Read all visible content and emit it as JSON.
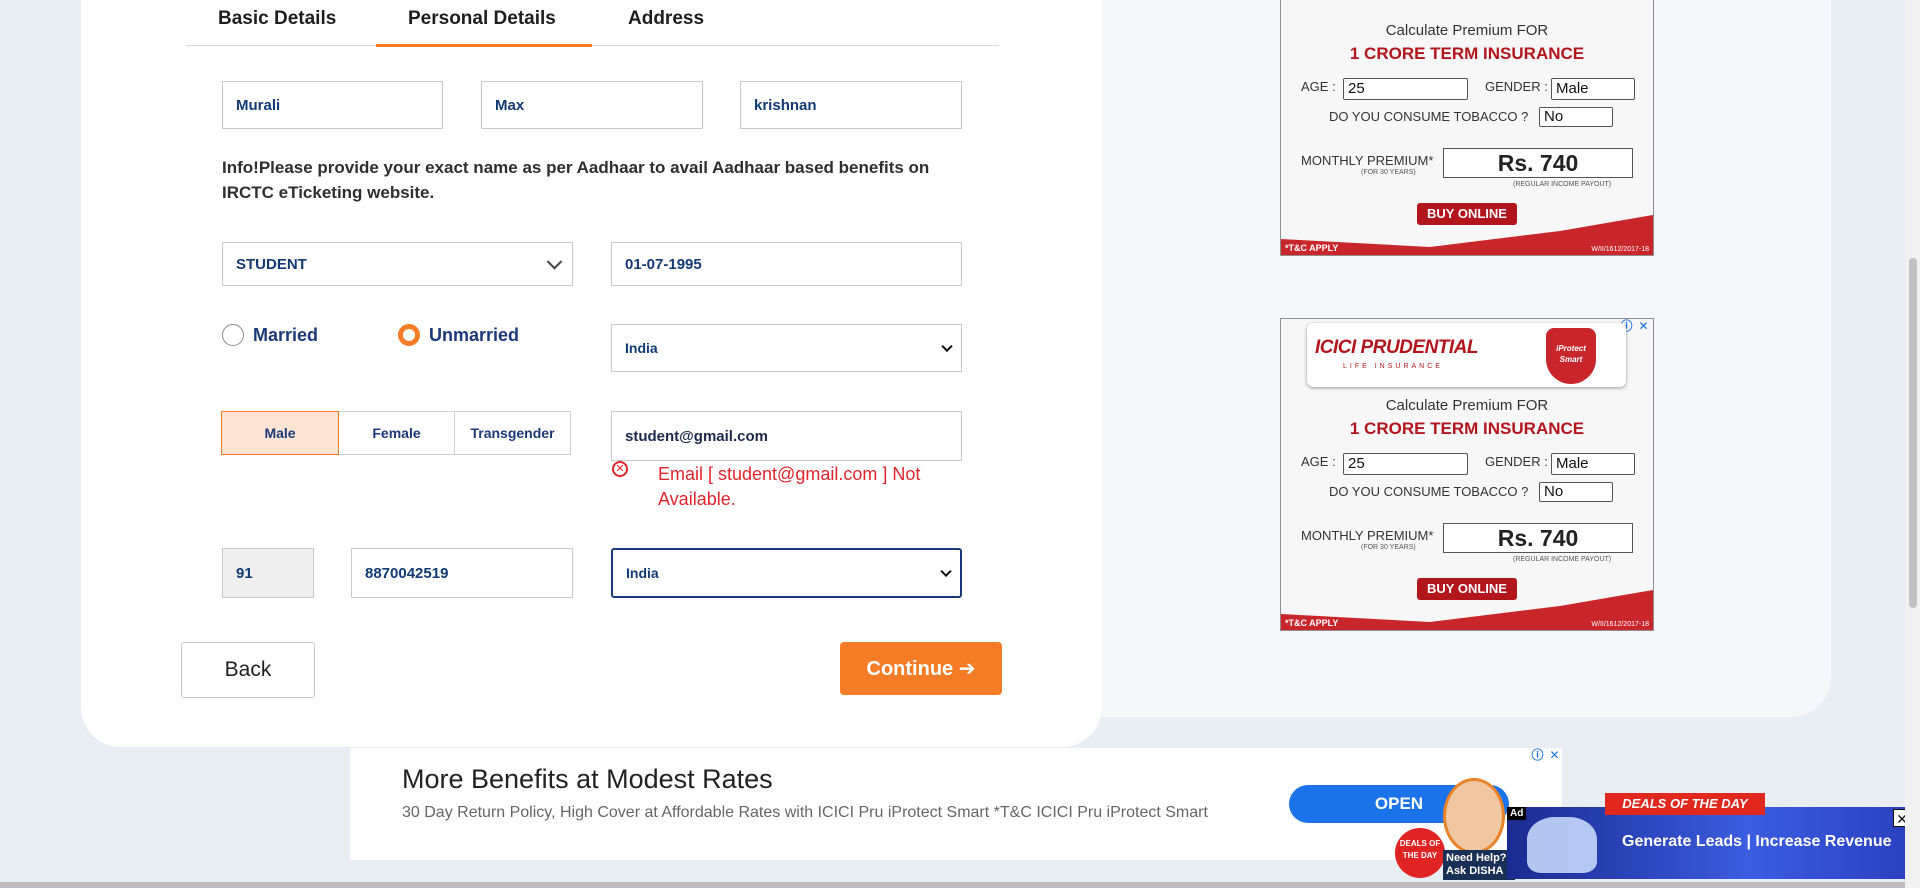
{
  "tabs": [
    "Basic Details",
    "Personal Details",
    "Address"
  ],
  "name": {
    "first": "Murali",
    "middle": "Max",
    "last": "krishnan"
  },
  "info_text": "Info!Please provide your exact name as per Aadhaar to avail Aadhaar based benefits on IRCTC eTicketing website.",
  "occupation": "STUDENT",
  "dob": "01-07-1995",
  "marital": {
    "married": "Married",
    "unmarried": "Unmarried",
    "selected": "Unmarried"
  },
  "country": "India",
  "gender": {
    "options": [
      "Male",
      "Female",
      "Transgender"
    ],
    "selected": "Male"
  },
  "email": "student@gmail.com",
  "email_error": "Email [ student@gmail.com ] Not Available.",
  "phone": {
    "isd": "91",
    "mobile": "8870042519",
    "nationality": "India"
  },
  "buttons": {
    "back": "Back",
    "continue": "Continue ➔"
  },
  "side_ad": {
    "brand": "ICICI PRUDENTIAL",
    "brand_sub": "LIFE INSURANCE",
    "shield": "iProtect Smart",
    "calc": "Calculate Premium FOR",
    "headline": "1 CRORE TERM INSURANCE",
    "age_label": "AGE :",
    "age_value": "25",
    "gender_label": "GENDER :",
    "gender_value": "Male",
    "tobacco_label": "DO YOU CONSUME TOBACCO ?",
    "tobacco_value": "No",
    "premium_label": "MONTHLY PREMIUM*",
    "premium_sub": "(FOR 30 YEARS)",
    "premium_value": "Rs. 740",
    "premium_note": "(REGULAR INCOME PAYOUT)",
    "buy": "BUY ONLINE",
    "tc": "*T&C APPLY",
    "code": "W/II/1612/2017-18"
  },
  "banner": {
    "title": "More Benefits at Modest Rates",
    "desc": "30 Day Return Policy, High Cover at Affordable Rates with ICICI Pru iProtect Smart *T&C ICICI Pru iProtect Smart",
    "open": "OPEN"
  },
  "disha": {
    "help": "Need Help? Ask DISHA",
    "badge": "DEALS OF THE DAY"
  },
  "deals": {
    "ribbon": "DEALS OF THE DAY",
    "text": "Generate Leads | Increase Revenue",
    "ad": "Ad"
  },
  "colors": {
    "accent": "#f47c27",
    "navy": "#1b3a7a",
    "error": "#e0262c",
    "ad_red": "#b3151d",
    "open_blue": "#1a73e8"
  }
}
